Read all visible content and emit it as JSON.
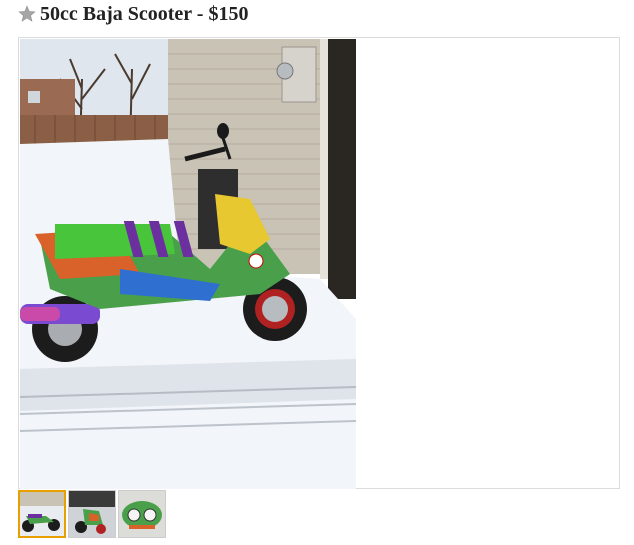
{
  "listing": {
    "title": "50cc Baja Scooter - $150"
  },
  "icons": {
    "favorite": "star-icon"
  },
  "colors": {
    "star": "#9a9a9a",
    "thumb_selected_border": "#e8a000"
  },
  "gallery": {
    "selected_index": 0,
    "thumbnail_count": 3
  }
}
